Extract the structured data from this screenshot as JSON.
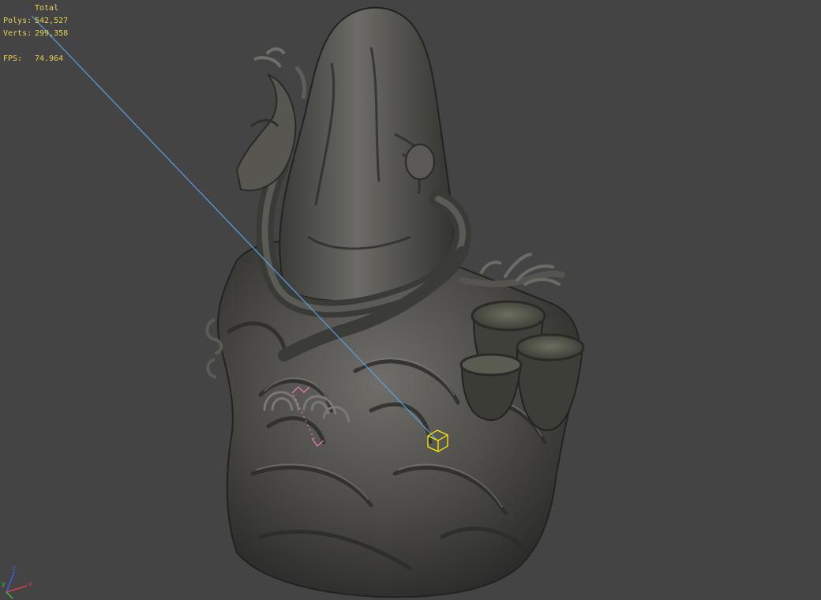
{
  "viewport": {
    "background": "#444444",
    "stats": {
      "title": "Total",
      "polys_label": "Polys:",
      "polys_value": "542,527",
      "verts_label": "Verts:",
      "verts_value": "299,358",
      "fps_label": "FPS:",
      "fps_value": "74.964",
      "text_color": "#e8d25a"
    },
    "axis_gizmo": {
      "x_label": "x",
      "y_label": "y",
      "z_label": "z",
      "x_color": "#d94040",
      "y_color": "#40c040",
      "z_color": "#4060e0"
    },
    "scene": {
      "model": "dragon-rock-sculpture",
      "selection_color": "#ffee00",
      "ray_color": "#5aa0e0",
      "light_marker_color": "#e07ab0"
    }
  }
}
